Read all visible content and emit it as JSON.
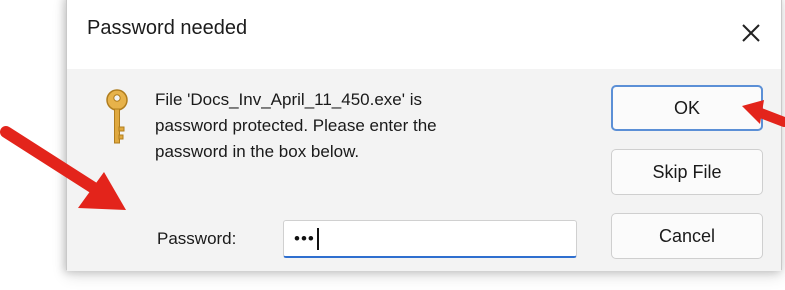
{
  "dialog": {
    "title": "Password needed",
    "message": "File 'Docs_Inv_April_11_450.exe' is\npassword protected.  Please enter the\npassword in the box below.",
    "password_label": "Password:",
    "password_value": "•••",
    "buttons": {
      "ok": "OK",
      "skip": "Skip File",
      "cancel": "Cancel"
    }
  },
  "icons": {
    "close": "close-icon",
    "key": "key-icon"
  },
  "annotations": {
    "arrow_color": "#e3241b"
  }
}
